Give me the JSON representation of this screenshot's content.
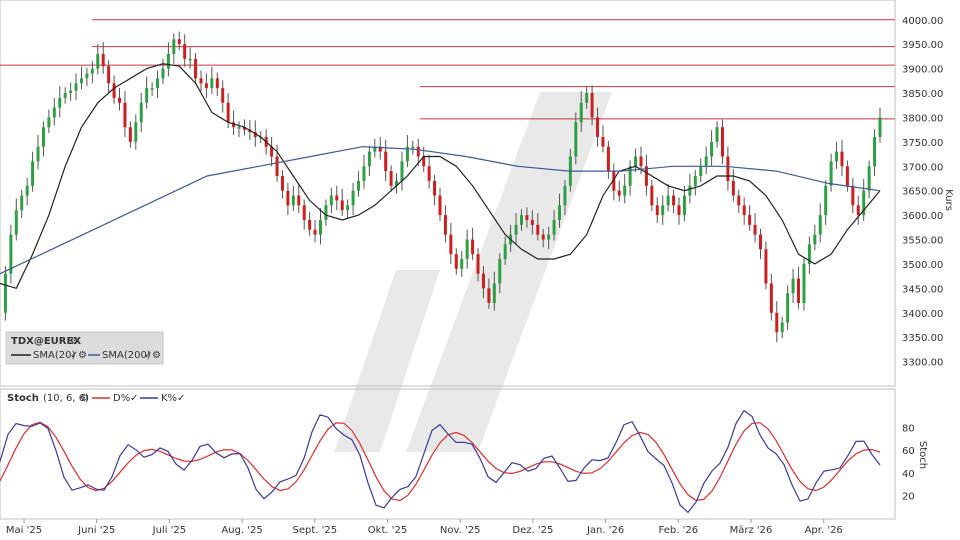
{
  "chart_data": [
    {
      "type": "candlestick",
      "name_label": "TDX@EUREX",
      "ylabel": "Kurs",
      "ylim": [
        3250,
        4020
      ],
      "y_ticks": [
        3300,
        3350,
        3400,
        3450,
        3500,
        3550,
        3600,
        3650,
        3700,
        3750,
        3800,
        3850,
        3900,
        3950,
        4000
      ],
      "y_tick_labels": [
        "3300.00",
        "3350.00",
        "3400.00",
        "3450.00",
        "3500.00",
        "3550.00",
        "3600.00",
        "3650.00",
        "3700.00",
        "3750.00",
        "3800.00",
        "3850.00",
        "3900.00",
        "3950.00",
        "4000.00"
      ],
      "x_labels": [
        "Mai '25",
        "Juni '25",
        "Juli '25",
        "Aug. '25",
        "Sept. '25",
        "Okt. '25",
        "Nov. '25",
        "Dez. '25",
        "Jan. '26",
        "Feb. '26",
        "März '26",
        "Apr. '26"
      ],
      "horizontal_lines": [
        {
          "value": 4000,
          "from": "Jun '25"
        },
        {
          "value": 3945,
          "from": "Jun '25"
        },
        {
          "value": 3907,
          "from": "Mai '25"
        },
        {
          "value": 3863,
          "from": "Okt. '25"
        },
        {
          "value": 3797,
          "from": "Okt. '25"
        }
      ],
      "close_path": [
        [
          0,
          3400
        ],
        [
          2,
          3480
        ],
        [
          4,
          3560
        ],
        [
          6,
          3610
        ],
        [
          8,
          3640
        ],
        [
          10,
          3660
        ],
        [
          12,
          3710
        ],
        [
          14,
          3740
        ],
        [
          16,
          3780
        ],
        [
          18,
          3800
        ],
        [
          20,
          3820
        ],
        [
          22,
          3840
        ],
        [
          24,
          3850
        ],
        [
          26,
          3855
        ],
        [
          28,
          3870
        ],
        [
          30,
          3880
        ],
        [
          32,
          3890
        ],
        [
          34,
          3900
        ],
        [
          36,
          3930
        ],
        [
          38,
          3905
        ],
        [
          40,
          3870
        ],
        [
          42,
          3840
        ],
        [
          44,
          3830
        ],
        [
          46,
          3780
        ],
        [
          48,
          3750
        ],
        [
          50,
          3790
        ],
        [
          52,
          3830
        ],
        [
          54,
          3860
        ],
        [
          56,
          3860
        ],
        [
          58,
          3880
        ],
        [
          60,
          3900
        ],
        [
          62,
          3930
        ],
        [
          64,
          3960
        ],
        [
          66,
          3950
        ],
        [
          68,
          3920
        ],
        [
          70,
          3920
        ],
        [
          72,
          3880
        ],
        [
          74,
          3870
        ],
        [
          76,
          3860
        ],
        [
          78,
          3880
        ],
        [
          80,
          3860
        ],
        [
          82,
          3830
        ],
        [
          84,
          3790
        ],
        [
          86,
          3780
        ],
        [
          88,
          3780
        ],
        [
          90,
          3775
        ],
        [
          92,
          3770
        ],
        [
          94,
          3760
        ],
        [
          96,
          3760
        ],
        [
          98,
          3740
        ],
        [
          100,
          3720
        ],
        [
          102,
          3680
        ],
        [
          104,
          3650
        ],
        [
          106,
          3620
        ],
        [
          108,
          3640
        ],
        [
          110,
          3620
        ],
        [
          112,
          3590
        ],
        [
          114,
          3570
        ],
        [
          116,
          3560
        ],
        [
          118,
          3590
        ],
        [
          120,
          3620
        ],
        [
          122,
          3640
        ],
        [
          124,
          3630
        ],
        [
          126,
          3610
        ],
        [
          128,
          3620
        ],
        [
          130,
          3650
        ],
        [
          132,
          3670
        ],
        [
          134,
          3700
        ],
        [
          136,
          3730
        ],
        [
          138,
          3740
        ],
        [
          140,
          3730
        ],
        [
          142,
          3690
        ],
        [
          144,
          3660
        ],
        [
          146,
          3670
        ],
        [
          148,
          3710
        ],
        [
          150,
          3740
        ],
        [
          152,
          3740
        ],
        [
          154,
          3720
        ],
        [
          156,
          3700
        ],
        [
          158,
          3670
        ],
        [
          160,
          3640
        ],
        [
          162,
          3600
        ],
        [
          164,
          3560
        ],
        [
          166,
          3520
        ],
        [
          168,
          3490
        ],
        [
          170,
          3510
        ],
        [
          172,
          3550
        ],
        [
          174,
          3520
        ],
        [
          176,
          3480
        ],
        [
          178,
          3450
        ],
        [
          180,
          3420
        ],
        [
          182,
          3460
        ],
        [
          184,
          3510
        ],
        [
          186,
          3540
        ],
        [
          188,
          3560
        ],
        [
          190,
          3580
        ],
        [
          192,
          3600
        ],
        [
          194,
          3590
        ],
        [
          196,
          3580
        ],
        [
          198,
          3560
        ],
        [
          200,
          3550
        ],
        [
          202,
          3560
        ],
        [
          204,
          3590
        ],
        [
          206,
          3620
        ],
        [
          208,
          3660
        ],
        [
          210,
          3720
        ],
        [
          212,
          3790
        ],
        [
          214,
          3830
        ],
        [
          216,
          3850
        ],
        [
          218,
          3800
        ],
        [
          220,
          3760
        ],
        [
          222,
          3740
        ],
        [
          224,
          3690
        ],
        [
          226,
          3650
        ],
        [
          228,
          3640
        ],
        [
          230,
          3660
        ],
        [
          232,
          3700
        ],
        [
          234,
          3720
        ],
        [
          236,
          3700
        ],
        [
          238,
          3660
        ],
        [
          240,
          3620
        ],
        [
          242,
          3600
        ],
        [
          244,
          3620
        ],
        [
          246,
          3640
        ],
        [
          248,
          3620
        ],
        [
          250,
          3600
        ],
        [
          252,
          3640
        ],
        [
          254,
          3660
        ],
        [
          256,
          3680
        ],
        [
          258,
          3700
        ],
        [
          260,
          3720
        ],
        [
          262,
          3750
        ],
        [
          264,
          3780
        ],
        [
          266,
          3720
        ],
        [
          268,
          3670
        ],
        [
          270,
          3640
        ],
        [
          272,
          3620
        ],
        [
          274,
          3600
        ],
        [
          276,
          3580
        ],
        [
          278,
          3560
        ],
        [
          280,
          3530
        ],
        [
          282,
          3460
        ],
        [
          284,
          3400
        ],
        [
          286,
          3360
        ],
        [
          288,
          3380
        ],
        [
          290,
          3440
        ],
        [
          292,
          3470
        ],
        [
          294,
          3420
        ],
        [
          296,
          3500
        ],
        [
          298,
          3540
        ],
        [
          300,
          3560
        ],
        [
          302,
          3600
        ],
        [
          304,
          3660
        ],
        [
          306,
          3710
        ],
        [
          308,
          3730
        ],
        [
          310,
          3700
        ],
        [
          312,
          3660
        ],
        [
          314,
          3620
        ],
        [
          316,
          3600
        ],
        [
          318,
          3650
        ],
        [
          320,
          3700
        ],
        [
          322,
          3760
        ],
        [
          324,
          3800
        ]
      ],
      "series": [
        {
          "name": "SMA(20)",
          "color": "#222222",
          "points": [
            [
              0,
              3460
            ],
            [
              10,
              3450
            ],
            [
              20,
              3520
            ],
            [
              30,
              3600
            ],
            [
              40,
              3700
            ],
            [
              50,
              3780
            ],
            [
              60,
              3830
            ],
            [
              70,
              3860
            ],
            [
              80,
              3880
            ],
            [
              90,
              3900
            ],
            [
              100,
              3910
            ],
            [
              110,
              3905
            ],
            [
              120,
              3870
            ],
            [
              130,
              3810
            ],
            [
              140,
              3790
            ],
            [
              150,
              3780
            ],
            [
              160,
              3760
            ],
            [
              170,
              3730
            ],
            [
              180,
              3680
            ],
            [
              190,
              3630
            ],
            [
              200,
              3600
            ],
            [
              210,
              3590
            ],
            [
              220,
              3600
            ],
            [
              230,
              3620
            ],
            [
              240,
              3650
            ],
            [
              250,
              3680
            ],
            [
              260,
              3720
            ],
            [
              270,
              3720
            ],
            [
              280,
              3700
            ],
            [
              290,
              3660
            ],
            [
              300,
              3610
            ],
            [
              310,
              3560
            ],
            [
              320,
              3530
            ],
            [
              330,
              3510
            ],
            [
              340,
              3510
            ],
            [
              350,
              3520
            ],
            [
              360,
              3560
            ],
            [
              370,
              3640
            ],
            [
              380,
              3690
            ],
            [
              390,
              3700
            ],
            [
              400,
              3680
            ],
            [
              410,
              3660
            ],
            [
              420,
              3650
            ],
            [
              430,
              3660
            ],
            [
              440,
              3680
            ],
            [
              450,
              3680
            ],
            [
              460,
              3670
            ],
            [
              470,
              3640
            ],
            [
              480,
              3590
            ],
            [
              490,
              3520
            ],
            [
              500,
              3500
            ],
            [
              510,
              3520
            ],
            [
              520,
              3570
            ],
            [
              530,
              3610
            ],
            [
              540,
              3650
            ]
          ]
        },
        {
          "name": "SMA(200)",
          "color": "#3d5a98",
          "points": [
            [
              0,
              3480
            ],
            [
              50,
              3530
            ],
            [
              100,
              3580
            ],
            [
              150,
              3630
            ],
            [
              200,
              3680
            ],
            [
              250,
              3700
            ],
            [
              300,
              3720
            ],
            [
              350,
              3740
            ],
            [
              400,
              3735
            ],
            [
              450,
              3720
            ],
            [
              500,
              3700
            ],
            [
              550,
              3690
            ],
            [
              600,
              3690
            ],
            [
              650,
              3700
            ],
            [
              700,
              3700
            ],
            [
              750,
              3690
            ],
            [
              800,
              3665
            ],
            [
              850,
              3650
            ]
          ]
        }
      ]
    },
    {
      "type": "line",
      "name_label": "Stoch",
      "params": "(10, 6, 6)",
      "ylabel": "Stoch",
      "ylim": [
        0,
        100
      ],
      "y_ticks": [
        20,
        40,
        60,
        80
      ],
      "series": [
        {
          "name": "D%",
          "color": "#d62f2f"
        },
        {
          "name": "K%",
          "color": "#3a3a9a"
        }
      ]
    }
  ],
  "legend": {
    "symbol": "TDX@EUREX",
    "sma20": "SMA(20)",
    "sma200": "SMA(200)",
    "stoch": "Stoch",
    "stoch_params": "(10, 6, 6)",
    "d_label": "D%",
    "k_label": "K%"
  },
  "colors": {
    "up": "#2ea043",
    "down": "#cc1f1f",
    "hline": "#c23b3b",
    "watermark": "#e6e6e6"
  }
}
